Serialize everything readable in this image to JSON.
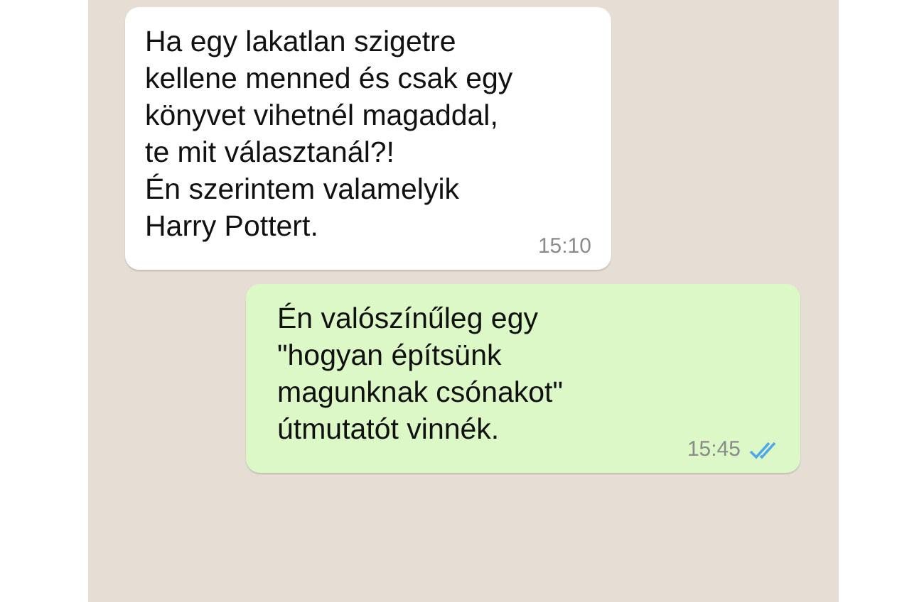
{
  "messages": [
    {
      "kind": "incoming",
      "lines": [
        "Ha egy lakatlan szigetre",
        "kellene menned és csak egy",
        "könyvet vihetnél magaddal,",
        "te mit választanál?!",
        "Én szerintem valamelyik",
        "Harry Pottert."
      ],
      "time": "15:10"
    },
    {
      "kind": "outgoing",
      "lines": [
        "Én valószínűleg egy",
        "\"hogyan építsünk",
        "magunknak csónakot\"",
        "útmutatót vinnék."
      ],
      "time": "15:45",
      "read": true
    }
  ]
}
